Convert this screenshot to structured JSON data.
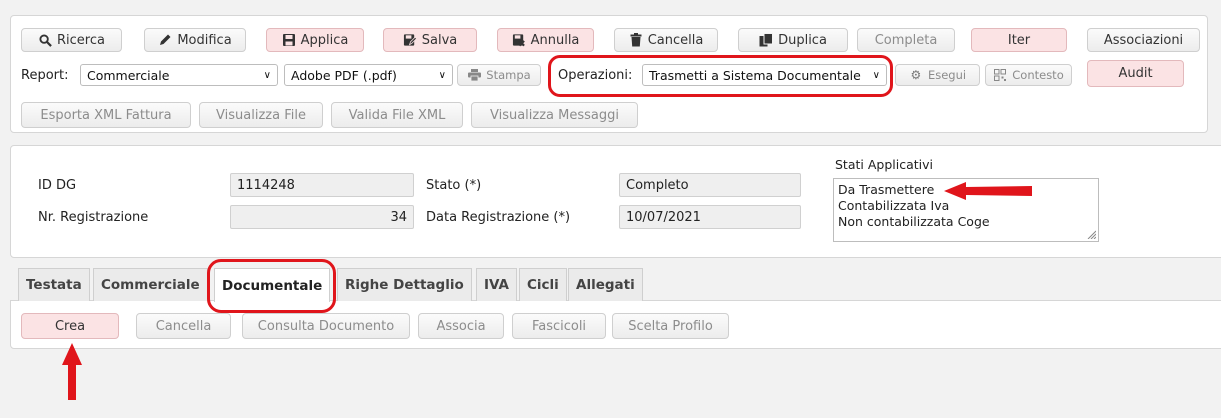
{
  "toolbar": {
    "ricerca": "Ricerca",
    "modifica": "Modifica",
    "applica": "Applica",
    "salva": "Salva",
    "annulla": "Annulla",
    "cancella": "Cancella",
    "duplica": "Duplica",
    "completa": "Completa",
    "iter": "Iter",
    "associazioni": "Associazioni"
  },
  "report": {
    "label": "Report:",
    "value": "Commerciale",
    "format_value": "Adobe PDF (.pdf)",
    "stampa": "Stampa"
  },
  "operazioni": {
    "label": "Operazioni:",
    "value": "Trasmetti a Sistema Documentale",
    "esegui": "Esegui",
    "contesto": "Contesto"
  },
  "audit": "Audit",
  "xml_buttons": {
    "esporta": "Esporta XML Fattura",
    "visualizza_file": "Visualizza File",
    "valida": "Valida File XML",
    "messaggi": "Visualizza Messaggi"
  },
  "form": {
    "id_dg_label": "ID DG",
    "id_dg_value": "1114248",
    "nr_reg_label": "Nr. Registrazione",
    "nr_reg_value": "34",
    "stato_label": "Stato (*)",
    "stato_value": "Completo",
    "data_reg_label": "Data Registrazione (*)",
    "data_reg_value": "10/07/2021",
    "stati_label": "Stati Applicativi",
    "stati_items": [
      "Da Trasmettere",
      "Contabilizzata Iva",
      "Non contabilizzata Coge"
    ]
  },
  "tabs": [
    "Testata",
    "Commerciale",
    "Documentale",
    "Righe Dettaglio",
    "IVA",
    "Cicli",
    "Allegati"
  ],
  "doc_buttons": {
    "crea": "Crea",
    "cancella": "Cancella",
    "consulta": "Consulta Documento",
    "associa": "Associa",
    "fascicoli": "Fascicoli",
    "scelta_profilo": "Scelta Profilo"
  },
  "colors": {
    "accent_pink": "#fbe3e4",
    "highlight_red": "#e0151b"
  },
  "icons": [
    "search-icon",
    "pencil-icon",
    "save-icon",
    "save-pen-icon",
    "cancel-icon",
    "trash-icon",
    "duplicate-icon",
    "print-icon",
    "gear-icon",
    "qr-icon"
  ]
}
